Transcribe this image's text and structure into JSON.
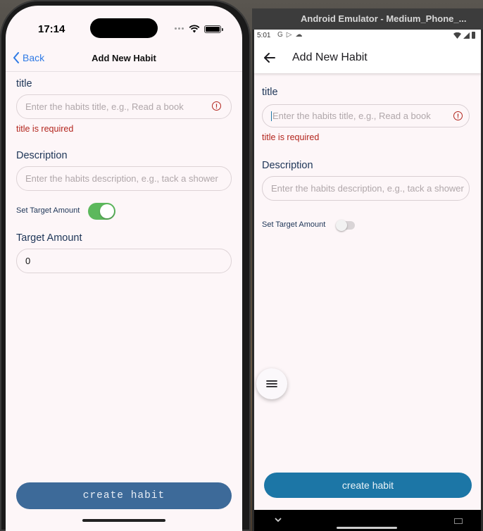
{
  "ios": {
    "time": "17:14",
    "back_label": "Back",
    "title": "Add New Habit",
    "title_field": {
      "label": "title",
      "placeholder": "Enter the habits title, e.g., Read a book",
      "error": "title is required"
    },
    "description_field": {
      "label": "Description",
      "placeholder": "Enter the habits description, e.g., tack a shower"
    },
    "toggle": {
      "label": "Set Target Amount",
      "on": true
    },
    "target_field": {
      "label": "Target Amount",
      "value": "0"
    },
    "create_button": "create habit"
  },
  "android": {
    "window_title": "Android Emulator - Medium_Phone_...",
    "time": "5:01",
    "status_icons": [
      "G",
      "▷",
      "☁"
    ],
    "title": "Add New Habit",
    "title_field": {
      "label": "title",
      "placeholder": "Enter the habits title, e.g., Read a book",
      "error": "title is required"
    },
    "description_field": {
      "label": "Description",
      "placeholder": "Enter the habits description, e.g., tack a shower"
    },
    "toggle": {
      "label": "Set Target Amount",
      "on": false
    },
    "create_button": "create habit"
  },
  "colors": {
    "ios_switch_on": "#5cb85c",
    "ios_button": "#3d6a99",
    "android_button": "#1c76a6",
    "error": "#b3261e",
    "label": "#1d3557"
  }
}
